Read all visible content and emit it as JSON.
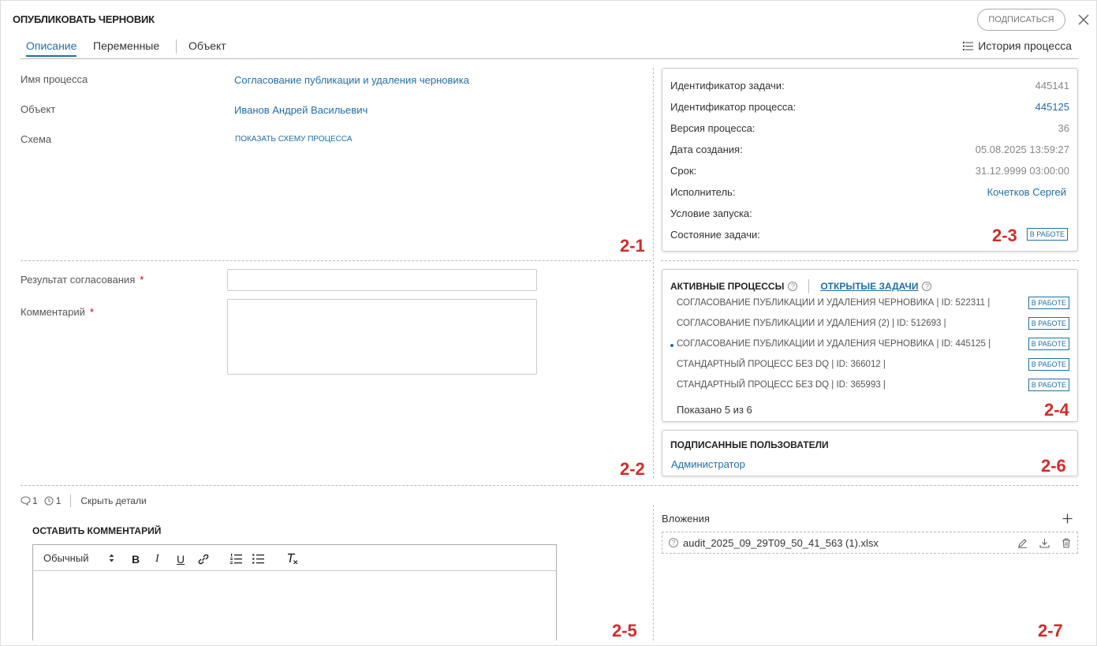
{
  "header": {
    "title": "ОПУБЛИКОВАТЬ ЧЕРНОВИК",
    "subscribe_label": "ПОДПИСАТЬСЯ"
  },
  "tabs": [
    {
      "label": "Описание",
      "active": true
    },
    {
      "label": "Переменные"
    },
    {
      "label": "Объект"
    }
  ],
  "history_label": "История процесса",
  "description": {
    "process_name_label": "Имя процесса",
    "process_name_value": "Согласование публикации и удаления черновика",
    "object_label": "Объект",
    "object_value": "Иванов Андрей Васильевич",
    "scheme_label": "Схема",
    "scheme_link": "ПОКАЗАТЬ СХЕМУ ПРОЦЕССА"
  },
  "task_info": {
    "rows": [
      {
        "key": "Идентификатор задачи:",
        "value": "445141"
      },
      {
        "key": "Идентификатор процесса:",
        "value": "445125"
      },
      {
        "key": "Версия процесса:",
        "value": "36"
      },
      {
        "key": "Дата создания:",
        "value": "05.08.2025 13:59:27"
      },
      {
        "key": "Срок:",
        "value": "31.12.9999 03:00:00"
      },
      {
        "key": "Исполнитель:",
        "value": "Кочетков Сергей"
      },
      {
        "key": "Условие запуска:",
        "value": ""
      },
      {
        "key": "Состояние задачи:",
        "value": "В РАБОТЕ"
      }
    ]
  },
  "form": {
    "result_label": "Результат согласования",
    "result_value": "",
    "comment_label": "Комментарий",
    "comment_value": "",
    "required_mark": "*"
  },
  "processes": {
    "active_title": "АКТИВНЫЕ ПРОЦЕССЫ",
    "open_tasks_title": "ОТКРЫТЫЕ ЗАДАЧИ",
    "items": [
      {
        "name": "СОГЛАСОВАНИЕ ПУБЛИКАЦИИ И УДАЛЕНИЯ ЧЕРНОВИКА | ID: 522311 |",
        "status": "В РАБОТЕ",
        "current": false
      },
      {
        "name": "СОГЛАСОВАНИЕ ПУБЛИКАЦИИ И УДАЛЕНИЯ (2) | ID: 512693 |",
        "status": "В РАБОТЕ",
        "current": false
      },
      {
        "name": "СОГЛАСОВАНИЕ ПУБЛИКАЦИИ И УДАЛЕНИЯ ЧЕРНОВИКА | ID: 445125 |",
        "status": "В РАБОТЕ",
        "current": true
      },
      {
        "name": "СТАНДАРТНЫЙ ПРОЦЕСС БЕЗ DQ | ID: 366012 |",
        "status": "В РАБОТЕ",
        "current": false
      },
      {
        "name": "СТАНДАРТНЫЙ ПРОЦЕСС БЕЗ DQ | ID: 365993 |",
        "status": "В РАБОТЕ",
        "current": false
      }
    ],
    "shown_text": "Показано 5 из 6"
  },
  "subscribers": {
    "title": "ПОДПИСАННЫЕ ПОЛЬЗОВАТЕЛИ",
    "users": [
      "Администратор"
    ]
  },
  "details_bar": {
    "comments_count": "1",
    "history_count": "1",
    "hide_label": "Скрыть детали"
  },
  "comment_editor": {
    "title": "ОСТАВИТЬ КОММЕНТАРИЙ",
    "style_select": "Обычный",
    "value": ""
  },
  "attachments": {
    "title": "Вложения",
    "files": [
      {
        "name": "audit_2025_09_29T09_50_41_563 (1).xlsx"
      }
    ]
  },
  "annotations": [
    "2-1",
    "2-2",
    "2-3",
    "2-4",
    "2-5",
    "2-6",
    "2-7"
  ],
  "colors": {
    "accent": "#1f6fa5",
    "annotation": "#d42a2a"
  }
}
